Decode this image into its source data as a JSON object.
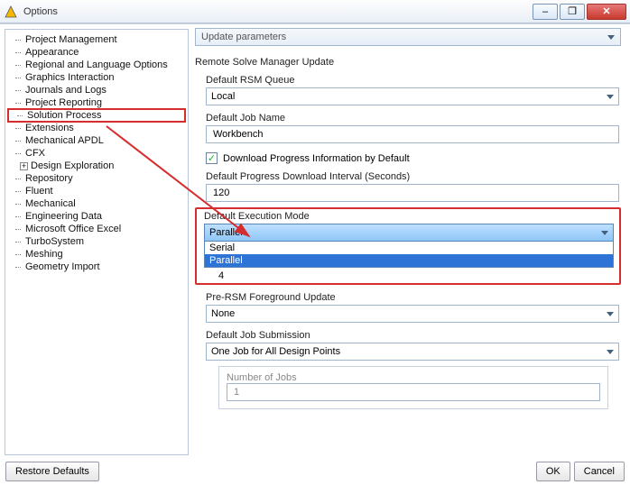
{
  "window": {
    "title": "Options"
  },
  "winbuttons": {
    "min": "–",
    "max": "❐",
    "close": "✕"
  },
  "tree": {
    "items": [
      "Project Management",
      "Appearance",
      "Regional and Language Options",
      "Graphics Interaction",
      "Journals and Logs",
      "Project Reporting",
      "Solution Process",
      "Extensions",
      "Mechanical APDL",
      "CFX",
      "Design Exploration",
      "Repository",
      "Fluent",
      "Mechanical",
      "Engineering Data",
      "Microsoft Office Excel",
      "TurboSystem",
      "Meshing",
      "Geometry Import"
    ],
    "highlighted_index": 6,
    "expander_index": 10,
    "expander_symbol": "+"
  },
  "content": {
    "top_combo": "Update parameters",
    "section": "Remote Solve Manager Update",
    "rsm_queue": {
      "label": "Default RSM Queue",
      "value": "Local"
    },
    "job_name": {
      "label": "Default Job Name",
      "value": "Workbench"
    },
    "download_cb": {
      "checked": true,
      "mark": "✓",
      "label": "Download Progress Information by Default"
    },
    "progress_interval": {
      "label": "Default Progress Download Interval (Seconds)",
      "value": "120"
    },
    "exec_mode": {
      "label": "Default Execution Mode",
      "value": "Parallel",
      "options": [
        "Serial",
        "Parallel"
      ],
      "num_after": "4"
    },
    "pre_rsm": {
      "label": "Pre-RSM Foreground Update",
      "value": "None"
    },
    "job_submission": {
      "label": "Default Job Submission",
      "value": "One Job for All Design Points"
    },
    "num_jobs": {
      "label": "Number of Jobs",
      "value": "1"
    }
  },
  "footer": {
    "restore": "Restore Defaults",
    "ok": "OK",
    "cancel": "Cancel"
  }
}
